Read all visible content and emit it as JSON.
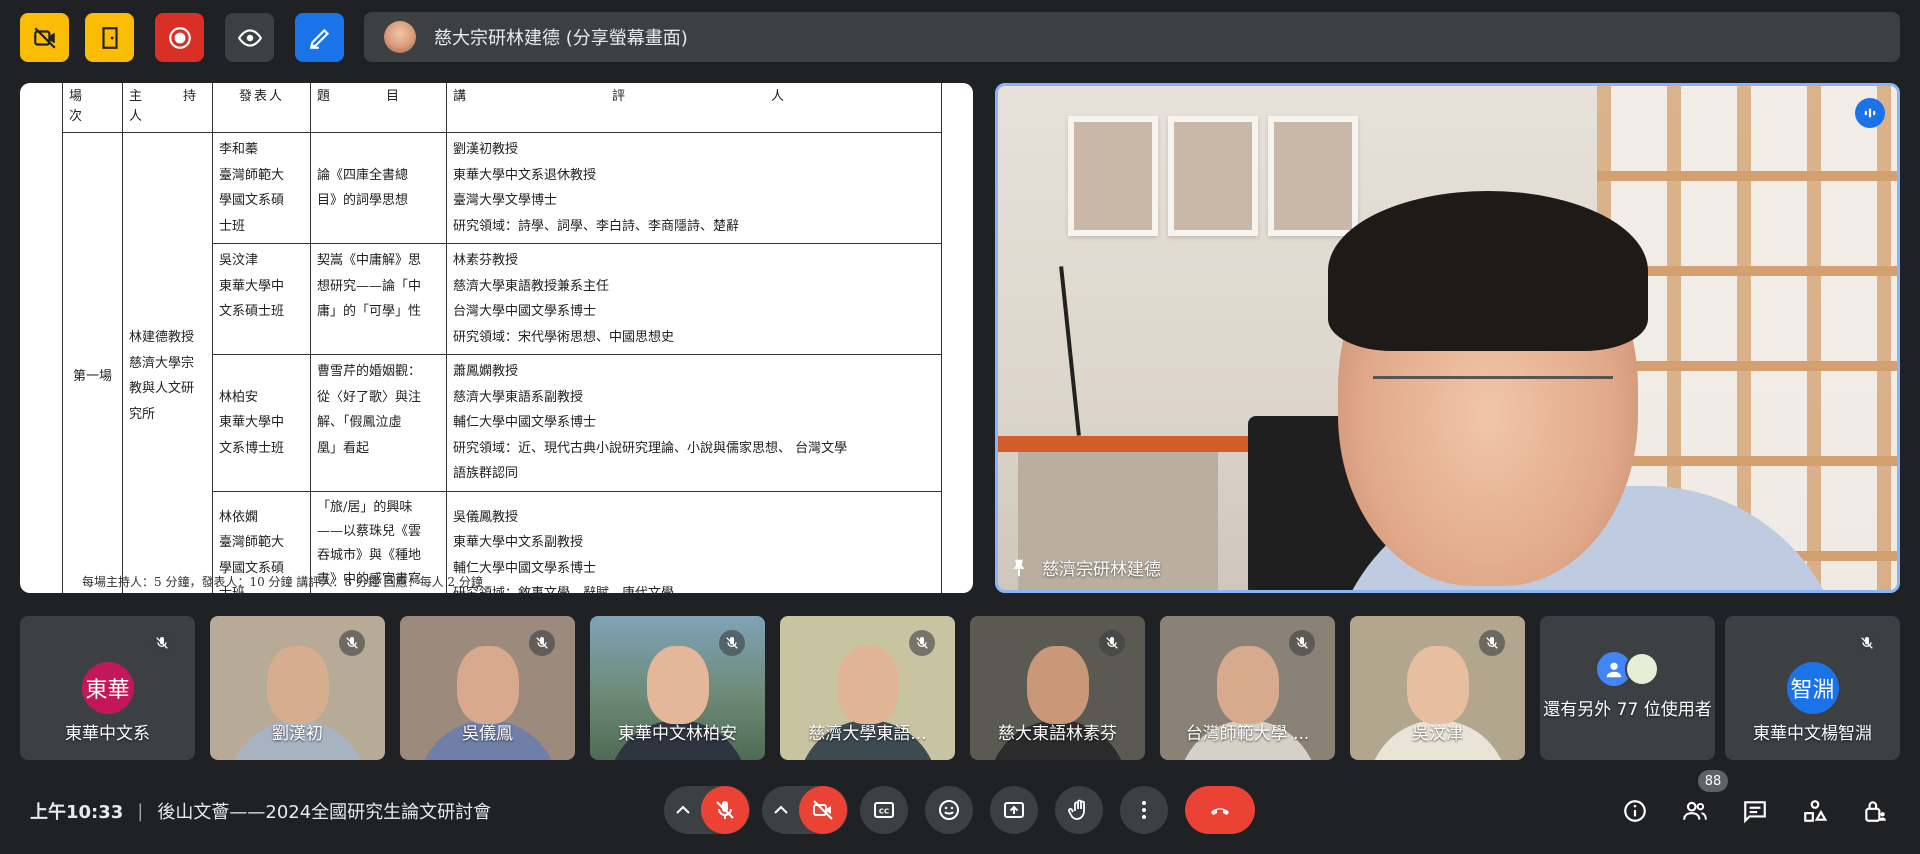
{
  "colors": {
    "background": "#202124",
    "surface": "#3c4043",
    "accent_blue": "#8ab4f8",
    "danger_red": "#ea4335",
    "warn_yellow": "#fbbc04",
    "brand_blue": "#1a73e8"
  },
  "top_bar": {
    "buttons": [
      {
        "icon": "camera-off-icon",
        "color": "#fbbc04"
      },
      {
        "icon": "door-icon",
        "color": "#fbbc04"
      },
      {
        "icon": "record-icon",
        "color": "#d93025"
      },
      {
        "icon": "eye-icon",
        "color": "#3c4043"
      },
      {
        "icon": "pen-icon",
        "color": "#1a73e8"
      }
    ],
    "share_banner": "慈大宗研林建德 (分享螢幕畫面)"
  },
  "document": {
    "headers": [
      "場　次",
      "主　持　人",
      "發表人",
      "題　　目",
      "講　　評　　人"
    ],
    "session": "第一場",
    "host": "林建德教授\n慈濟大學宗\n教與人文研\n究所",
    "rows": [
      {
        "presenter": "李和蓁\n臺灣師範大\n學國文系碩\n士班",
        "title": "論《四庫全書總\n目》的詞學思想",
        "reviewer": "劉漢初教授\n東華大學中文系退休教授\n臺灣大學文學博士\n研究領域：詩學、詞學、李白詩、李商隱詩、楚辭"
      },
      {
        "presenter": "吳汶津\n東華大學中\n文系碩士班",
        "title": "契嵩《中庸解》思\n想研究——論「中\n庸」的「可學」性",
        "reviewer": "林素芬教授\n慈濟大學東語教授兼系主任\n台灣大學中國文學系博士\n研究領域：宋代學術思想、中國思想史"
      },
      {
        "presenter": "林柏安\n東華大學中\n文系博士班",
        "title": "曹雪芹的婚姻觀：\n從〈好了歌〉與注\n解、「假鳳泣虛\n凰」看起",
        "reviewer": "蕭鳳嫻教授\n慈濟大學東語系副教授\n輔仁大學中國文學系博士\n研究領域：近、現代古典小說研究理論、小說與儒家思想、 台灣文學\n語族群認同"
      },
      {
        "presenter": "林依嫻\n臺灣師範大\n學國文系碩\n士班",
        "title": "「旅/居」的興味\n——以蔡珠兒《雲\n吞城市》與《種地\n書》中的感官書寫\n為線索",
        "reviewer": "吳儀鳳教授\n東華大學中文系副教授\n輔仁大學中國文學系博士\n研究領域：敘事文學、辭賦、唐代文學"
      }
    ],
    "footer": "每場主持人：5 分鐘，發表人：10 分鐘  講評人：8 分鐘  回應：每人 2 分鐘"
  },
  "speaker": {
    "name": "慈濟宗研林建德",
    "pin_icon": "pin-icon",
    "audio_icon": "audio-level-icon"
  },
  "tiles": [
    {
      "name": "東華中文系",
      "type": "initial",
      "initial": "東華",
      "avatar_color": "#c2185b"
    },
    {
      "name": "劉漢初",
      "type": "video",
      "bg": "#b7aa96",
      "face": "#d7ad90",
      "body": "#a8b3c2"
    },
    {
      "name": "吳儀鳳",
      "type": "video",
      "bg": "#9c8a7c",
      "face": "#d9a98e",
      "body": "#6f7fa8"
    },
    {
      "name": "東華中文林柏安",
      "type": "video",
      "bg": "#6d8a77",
      "face": "#e4b79a",
      "body": "#2e3440"
    },
    {
      "name": "慈濟大學東語...",
      "type": "video",
      "bg": "#c8c4a2",
      "face": "#e0b595",
      "body": "#3d4a52"
    },
    {
      "name": "慈大東語林素芬",
      "type": "video",
      "bg": "#5a5a52",
      "face": "#c99878",
      "body": "#2c2c2c"
    },
    {
      "name": "台灣師範大學 ...",
      "type": "video",
      "bg": "#8a8276",
      "face": "#d7aa8e",
      "body": "#d6d1c8"
    },
    {
      "name": "吳汶津",
      "type": "video",
      "bg": "#b2a78e",
      "face": "#e7be9f",
      "body": "#e9e3d8"
    },
    {
      "name": "還有另外 77 位使用者",
      "type": "others"
    },
    {
      "name": "東華中文楊智淵",
      "type": "initial",
      "initial": "智淵",
      "avatar_color": "#1a73e8"
    }
  ],
  "bottom": {
    "time": "上午10:33",
    "meeting_title": "後山文薈——2024全國研究生論文研討會",
    "participant_count": "88"
  }
}
